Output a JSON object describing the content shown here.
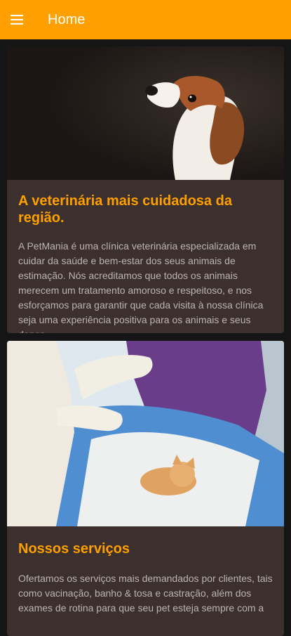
{
  "app": {
    "title": "Home",
    "menu_icon": "menu-icon",
    "accent": "#ff9f00"
  },
  "cards": [
    {
      "image": "beagle-puppy-photo",
      "title": "A veterinária mais cuidadosa da região.",
      "text": "A PetMania é uma clínica veterinária especializada em cuidar da saúde e bem-estar dos seus animais de estimação. Nós acreditamos que todos os animais merecem um tratamento amoroso e respeitoso, e nos esforçamos para garantir que cada visita à nossa clínica seja uma experiência positiva para os animais e seus donos."
    },
    {
      "image": "vet-treating-kitten-photo",
      "title": "Nossos serviços",
      "text": "Ofertamos os serviços mais demandados por clientes, tais como vacinação, banho & tosa e castração, além dos exames de rotina para que seu pet esteja sempre com a"
    }
  ]
}
